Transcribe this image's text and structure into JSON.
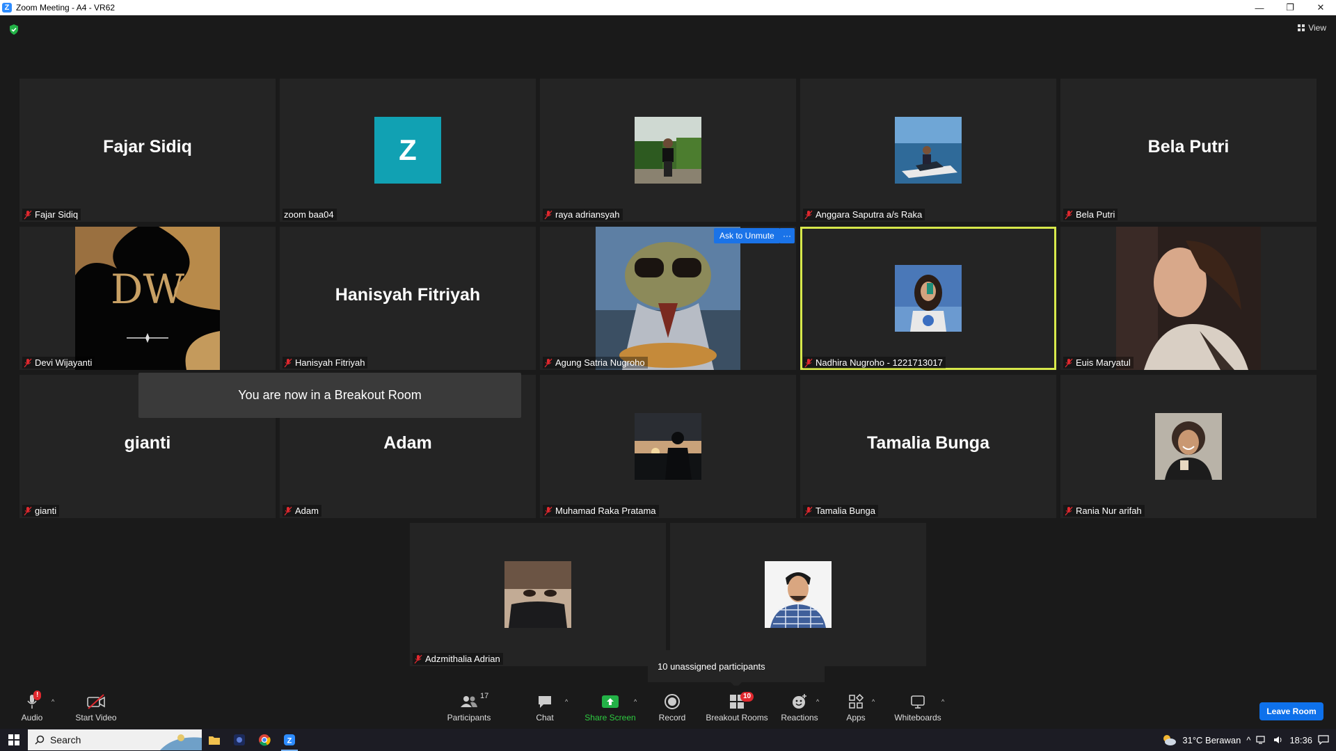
{
  "window": {
    "title": "Zoom Meeting - A4 - VR62",
    "minimize": "—",
    "restore": "❐",
    "close": "✕"
  },
  "top": {
    "view_label": "View"
  },
  "tiles": [
    {
      "name": "Fajar Sidiq",
      "big": "Fajar Sidiq"
    },
    {
      "name": "zoom baa04",
      "letter": "Z"
    },
    {
      "name": "raya adriansyah"
    },
    {
      "name": "Anggara Saputra a/s Raka"
    },
    {
      "name": "Bela Putri",
      "big": "Bela Putri"
    },
    {
      "name": "Devi Wijayanti",
      "logo": "DW"
    },
    {
      "name": "Hanisyah Fitriyah",
      "big": "Hanisyah Fitriyah"
    },
    {
      "name": "Agung Satria Nugroho"
    },
    {
      "name": "Nadhira Nugroho - 1221713017"
    },
    {
      "name": "Euis Maryatul"
    },
    {
      "name": "gianti",
      "big": "gianti"
    },
    {
      "name": "Adam",
      "big": "Adam"
    },
    {
      "name": "Muhamad Raka Pratama"
    },
    {
      "name": "Tamalia Bunga",
      "big": "Tamalia Bunga"
    },
    {
      "name": "Rania Nur arifah"
    },
    {
      "name": "Adzmithalia Adrian"
    },
    {
      "name": ""
    }
  ],
  "overlays": {
    "breakout_toast": "You are now in a Breakout Room",
    "ask_to_unmute": "Ask to Unmute",
    "more": "···",
    "unassigned": "10 unassigned participants"
  },
  "toolbar": {
    "audio": "Audio",
    "audio_badge": "!",
    "start_video": "Start Video",
    "participants": "Participants",
    "participants_count": "17",
    "chat": "Chat",
    "share_screen": "Share Screen",
    "record": "Record",
    "breakout_rooms": "Breakout Rooms",
    "breakout_badge": "10",
    "reactions": "Reactions",
    "apps": "Apps",
    "whiteboards": "Whiteboards",
    "leave": "Leave Room"
  },
  "taskbar": {
    "search": "Search",
    "weather": "31°C  Berawan",
    "time": "18:36"
  },
  "colors": {
    "active_border": "#d7e84b",
    "zoom_blue": "#0e71eb",
    "share_green": "#2ecc40",
    "badge_red": "#e0282e",
    "z_avatar": "#11a1b3"
  }
}
